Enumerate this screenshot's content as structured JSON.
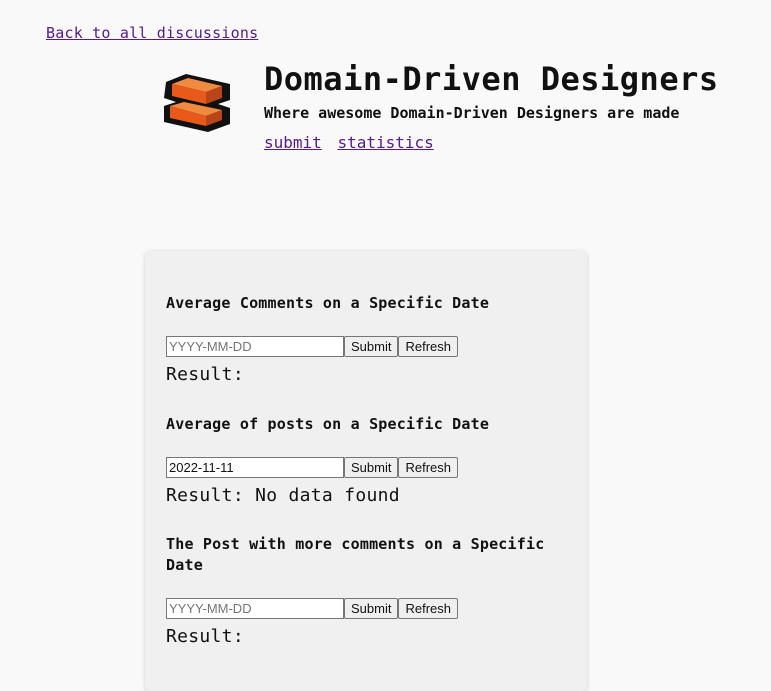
{
  "nav": {
    "back_label": "Back to all discussions"
  },
  "brand": {
    "title": "Domain-Driven Designers",
    "subtitle": "Where awesome Domain-Driven Designers are made",
    "links": [
      {
        "label": "submit"
      },
      {
        "label": "statistics"
      }
    ],
    "logo_colors": {
      "outline": "#111111",
      "top_face": "#f08a40",
      "front_face": "#e85a1a",
      "side_face": "#b8461a"
    }
  },
  "colors": {
    "page_bg": "#f9f9f9",
    "card_bg": "#f0f0f0",
    "link": "#551a8b"
  },
  "stats": {
    "sections": [
      {
        "title": "Average Comments on a Specific Date",
        "input_value": "",
        "input_placeholder": "YYYY-MM-DD",
        "submit_label": "Submit",
        "refresh_label": "Refresh",
        "result_text": "Result:"
      },
      {
        "title": "Average of posts on a Specific Date",
        "input_value": "2022-11-11",
        "input_placeholder": "YYYY-MM-DD",
        "submit_label": "Submit",
        "refresh_label": "Refresh",
        "result_text": "Result: No data found"
      },
      {
        "title": "The Post with more comments on a Specific Date",
        "input_value": "",
        "input_placeholder": "YYYY-MM-DD",
        "submit_label": "Submit",
        "refresh_label": "Refresh",
        "result_text": "Result:"
      }
    ]
  }
}
